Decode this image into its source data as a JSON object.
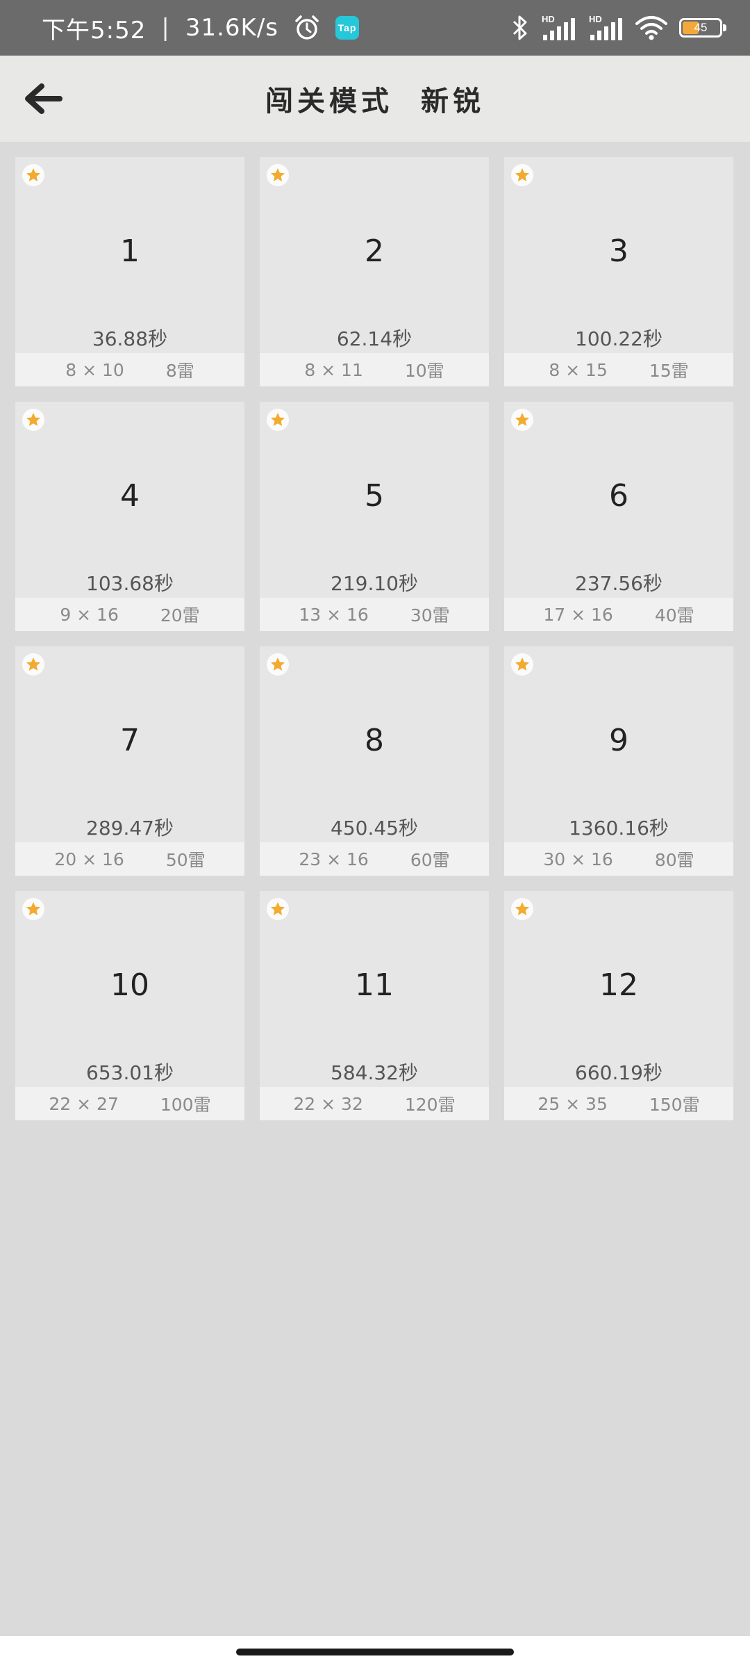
{
  "status_bar": {
    "time": "下午5:52",
    "separator": "|",
    "net_speed": "31.6K/s",
    "battery_level": "45",
    "battery_fraction": 0.45,
    "icons": [
      "alarm-icon",
      "tap-app-icon",
      "bluetooth-icon",
      "signal-hd-icon",
      "signal-hd-icon",
      "wifi-icon",
      "battery-icon"
    ],
    "tap_label": "Tap",
    "hd_label": "HD"
  },
  "app_bar": {
    "back_icon": "arrow-left-icon",
    "title_mode": "闯关模式",
    "title_level": "新锐"
  },
  "colors": {
    "status_bar_bg": "#6b6b6b",
    "app_bar_bg": "#e8e8e7",
    "page_bg": "#dadada",
    "card_bg": "#e6e6e6",
    "card_footer_bg": "#f1f1f1",
    "star": "#f2ab2e",
    "battery_fill": "#f3a93a",
    "tap_badge": "#25c7d9"
  },
  "levels": [
    {
      "number": "1",
      "time": "36.88秒",
      "size": "8 × 10",
      "mines": "8雷",
      "starred": true
    },
    {
      "number": "2",
      "time": "62.14秒",
      "size": "8 × 11",
      "mines": "10雷",
      "starred": true
    },
    {
      "number": "3",
      "time": "100.22秒",
      "size": "8 × 15",
      "mines": "15雷",
      "starred": true
    },
    {
      "number": "4",
      "time": "103.68秒",
      "size": "9 × 16",
      "mines": "20雷",
      "starred": true
    },
    {
      "number": "5",
      "time": "219.10秒",
      "size": "13 × 16",
      "mines": "30雷",
      "starred": true
    },
    {
      "number": "6",
      "time": "237.56秒",
      "size": "17 × 16",
      "mines": "40雷",
      "starred": true
    },
    {
      "number": "7",
      "time": "289.47秒",
      "size": "20 × 16",
      "mines": "50雷",
      "starred": true
    },
    {
      "number": "8",
      "time": "450.45秒",
      "size": "23 × 16",
      "mines": "60雷",
      "starred": true
    },
    {
      "number": "9",
      "time": "1360.16秒",
      "size": "30 × 16",
      "mines": "80雷",
      "starred": true
    },
    {
      "number": "10",
      "time": "653.01秒",
      "size": "22 × 27",
      "mines": "100雷",
      "starred": true
    },
    {
      "number": "11",
      "time": "584.32秒",
      "size": "22 × 32",
      "mines": "120雷",
      "starred": true
    },
    {
      "number": "12",
      "time": "660.19秒",
      "size": "25 × 35",
      "mines": "150雷",
      "starred": true
    }
  ]
}
